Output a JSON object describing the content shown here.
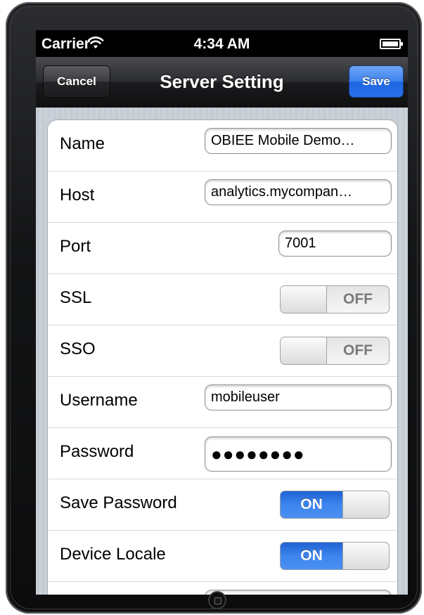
{
  "status_bar": {
    "carrier": "Carrier",
    "time": "4:34 AM",
    "wifi_icon": "wifi-icon",
    "battery_icon": "battery-icon"
  },
  "nav": {
    "title": "Server Setting",
    "cancel_label": "Cancel",
    "save_label": "Save"
  },
  "rows": {
    "name": {
      "label": "Name",
      "value": "OBIEE Mobile Demo…"
    },
    "host": {
      "label": "Host",
      "value": "analytics.mycompan…"
    },
    "port": {
      "label": "Port",
      "value": "7001"
    },
    "ssl": {
      "label": "SSL",
      "state": "OFF"
    },
    "sso": {
      "label": "SSO",
      "state": "OFF"
    },
    "username": {
      "label": "Username",
      "value": "mobileuser"
    },
    "password": {
      "label": "Password",
      "value": "●●●●●●●●"
    },
    "save_password": {
      "label": "Save Password",
      "state": "ON"
    },
    "device_locale": {
      "label": "Device Locale",
      "state": "ON"
    }
  },
  "colors": {
    "accent_blue": "#3f82ee",
    "nav_dark": "#1a1b1d",
    "table_bg": "#c5ccd4"
  }
}
